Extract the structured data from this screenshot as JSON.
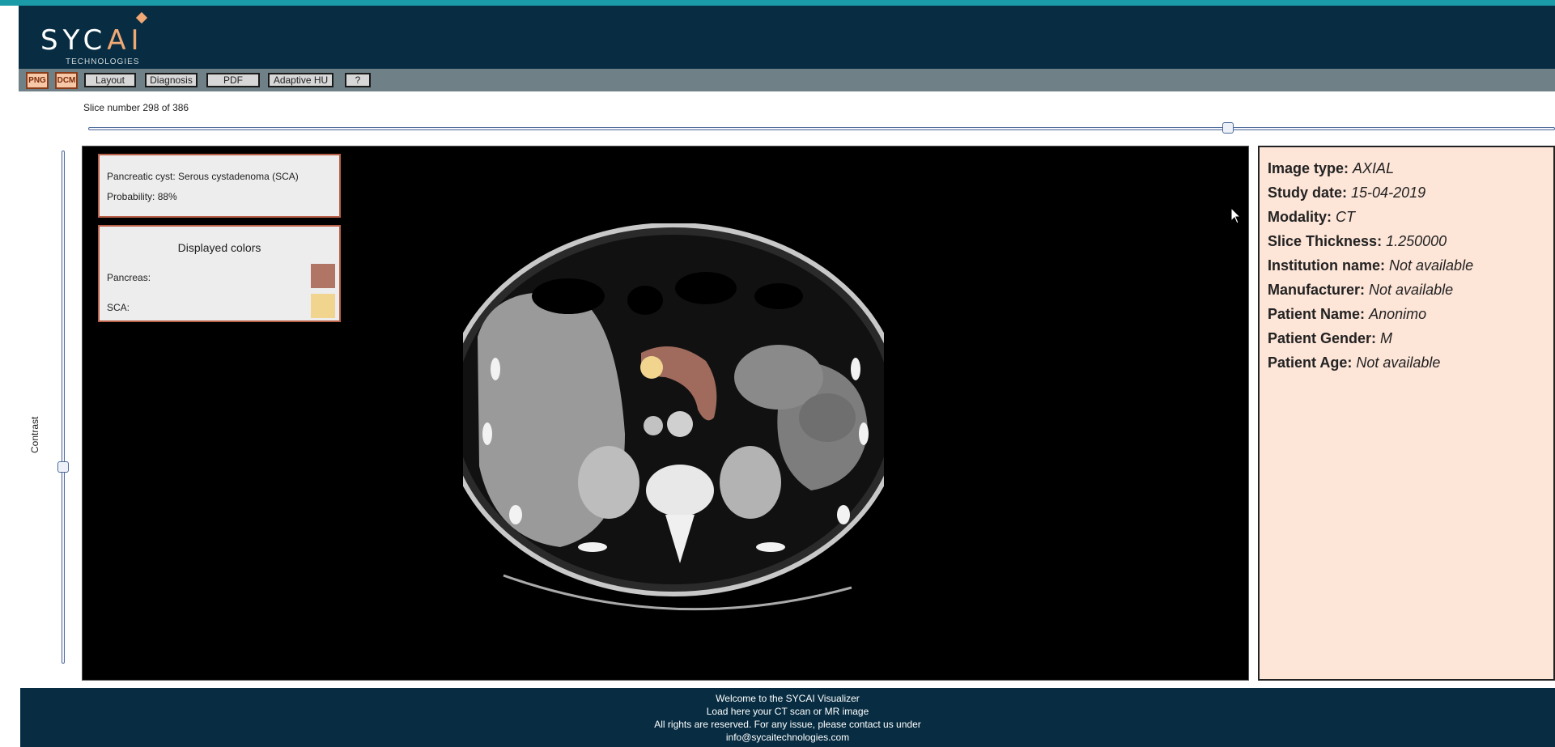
{
  "logo": {
    "word_main": "SYC",
    "word_accent": "AI",
    "subtitle": "TECHNOLOGIES"
  },
  "toolbar": {
    "png_label": "PNG",
    "dcm_label": "DCM",
    "layout_label": "Layout",
    "diagnosis_label": "Diagnosis",
    "pdf_label": "PDF",
    "adaptive_label": "Adaptive HU",
    "help_label": "?"
  },
  "slice": {
    "label": "Slice number 298 of 386",
    "current": 298,
    "total": 386
  },
  "contrast": {
    "label": "Contrast"
  },
  "diagnosis": {
    "finding": "Pancreatic cyst: Serous cystadenoma (SCA)",
    "probability": "Probability: 88%"
  },
  "colors": {
    "title": "Displayed colors",
    "items": [
      {
        "label": "Pancreas:",
        "color": "#b07565"
      },
      {
        "label": "SCA:",
        "color": "#f1d58e"
      }
    ]
  },
  "info": {
    "image_type_key": "Image type:",
    "image_type_val": "AXIAL",
    "study_date_key": "Study date:",
    "study_date_val": "15-04-2019",
    "modality_key": "Modality:",
    "modality_val": "CT",
    "thickness_key": "Slice Thickness:",
    "thickness_val": "1.250000",
    "institution_key": "Institution name:",
    "institution_val": "Not available",
    "manufacturer_key": "Manufacturer:",
    "manufacturer_val": "Not available",
    "patient_name_key": "Patient Name:",
    "patient_name_val": "Anonimo",
    "patient_gender_key": "Patient Gender:",
    "patient_gender_val": "M",
    "patient_age_key": "Patient Age:",
    "patient_age_val": "Not available"
  },
  "footer": {
    "line1": "Welcome to the SYCAI Visualizer",
    "line2": "Load here your CT scan or MR image",
    "line3": "All rights are reserved. For any issue, please contact us under",
    "line4": "info@sycaitechnologies.com"
  }
}
